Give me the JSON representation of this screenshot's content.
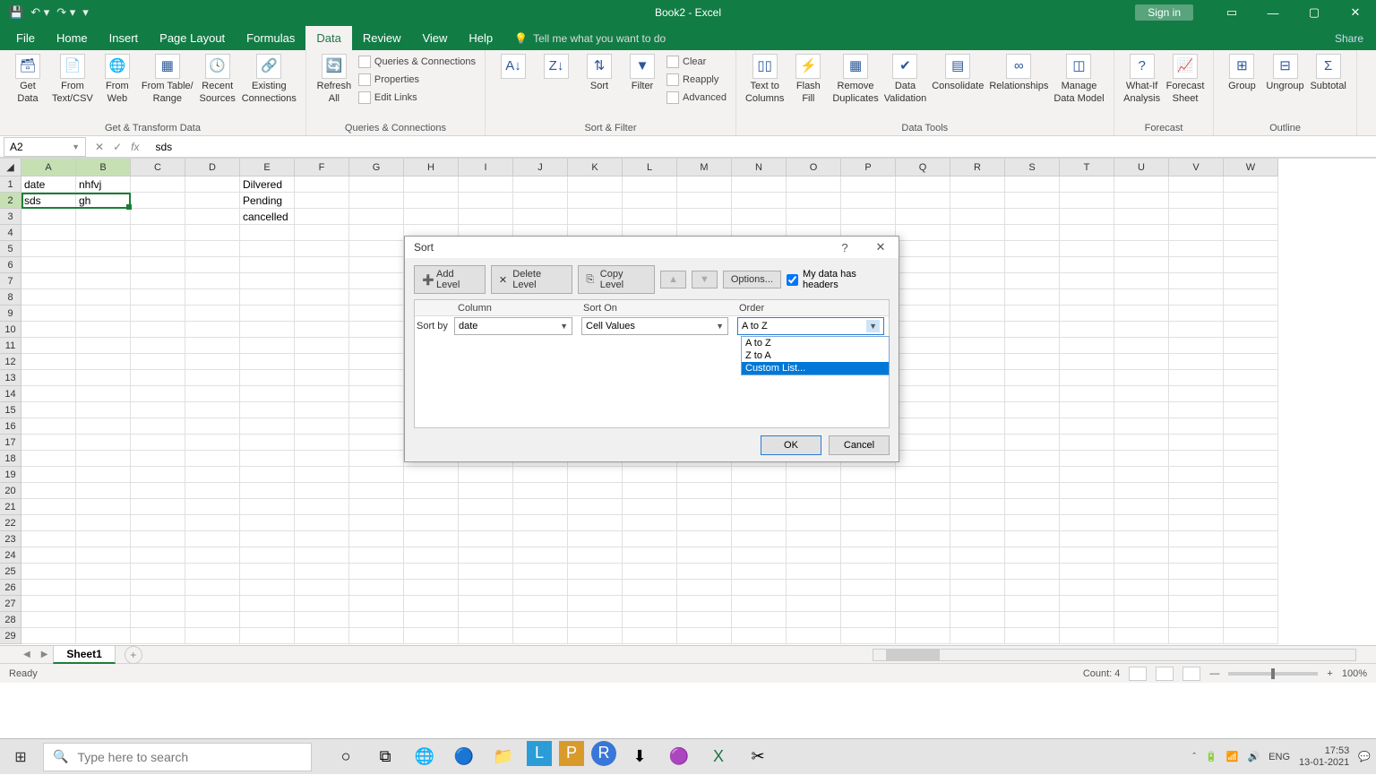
{
  "titlebar": {
    "title": "Book2 - Excel",
    "signin": "Sign in"
  },
  "menu": {
    "tabs": [
      "File",
      "Home",
      "Insert",
      "Page Layout",
      "Formulas",
      "Data",
      "Review",
      "View",
      "Help"
    ],
    "tellme": "Tell me what you want to do",
    "share": "Share"
  },
  "ribbon": {
    "group1": {
      "btn1a": "Get",
      "btn1b": "Data",
      "btn2a": "From",
      "btn2b": "Text/CSV",
      "btn3a": "From",
      "btn3b": "Web",
      "btn4a": "From Table/",
      "btn4b": "Range",
      "btn5a": "Recent",
      "btn5b": "Sources",
      "btn6a": "Existing",
      "btn6b": "Connections",
      "label": "Get & Transform Data"
    },
    "group2": {
      "btn1a": "Refresh",
      "btn1b": "All",
      "r1": "Queries & Connections",
      "r2": "Properties",
      "r3": "Edit Links",
      "label": "Queries & Connections"
    },
    "group3": {
      "sort": "Sort",
      "filter": "Filter",
      "r1": "Clear",
      "r2": "Reapply",
      "r3": "Advanced",
      "label": "Sort & Filter"
    },
    "group4": {
      "b1a": "Text to",
      "b1b": "Columns",
      "b2a": "Flash",
      "b2b": "Fill",
      "b3a": "Remove",
      "b3b": "Duplicates",
      "b4a": "Data",
      "b4b": "Validation",
      "b5": "Consolidate",
      "b6": "Relationships",
      "b7a": "Manage",
      "b7b": "Data Model",
      "label": "Data Tools"
    },
    "group5": {
      "b1a": "What-If",
      "b1b": "Analysis",
      "b2a": "Forecast",
      "b2b": "Sheet",
      "label": "Forecast"
    },
    "group6": {
      "b1": "Group",
      "b2": "Ungroup",
      "b3": "Subtotal",
      "label": "Outline"
    }
  },
  "formula": {
    "name": "A2",
    "value": "sds"
  },
  "columns": [
    "A",
    "B",
    "C",
    "D",
    "E",
    "F",
    "G",
    "H",
    "I",
    "J",
    "K",
    "L",
    "M",
    "N",
    "O",
    "P",
    "Q",
    "R",
    "S",
    "T",
    "U",
    "V",
    "W"
  ],
  "cells": {
    "A1": "date",
    "B1": "nhfvj",
    "A2": "sds",
    "B2": "gh",
    "E1": "Dilvered",
    "E2": "Pending",
    "E3": "cancelled"
  },
  "dialog": {
    "title": "Sort",
    "add": "Add Level",
    "del": "Delete Level",
    "copy": "Copy Level",
    "opts": "Options...",
    "headers": "My data has headers",
    "colhead": "Column",
    "sortonhead": "Sort On",
    "orderhead": "Order",
    "sortby": "Sort by",
    "colval": "date",
    "sorton": "Cell Values",
    "order": "A to Z",
    "opts1": "A to Z",
    "opts2": "Z to A",
    "opts3": "Custom List...",
    "ok": "OK",
    "cancel": "Cancel"
  },
  "sheet": {
    "name": "Sheet1"
  },
  "status": {
    "ready": "Ready",
    "count": "Count: 4",
    "zoom": "100%"
  },
  "taskbar": {
    "search": "Type here to search",
    "lang": "ENG",
    "time": "17:53",
    "date": "13-01-2021"
  }
}
